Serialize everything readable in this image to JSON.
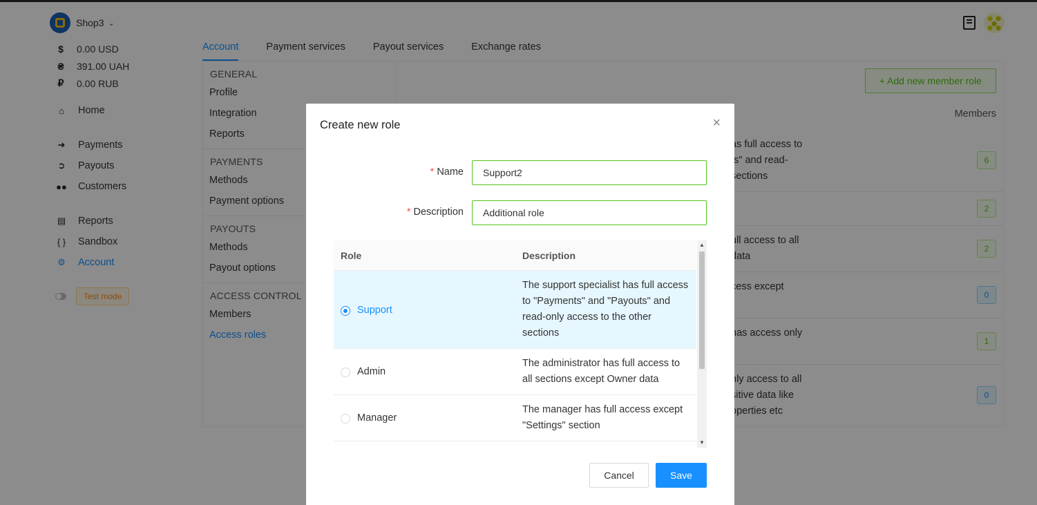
{
  "shop": {
    "name": "Shop3"
  },
  "balances": [
    {
      "symbol": "$",
      "amount": "0.00 USD"
    },
    {
      "symbol": "₴",
      "amount": "391.00 UAH"
    },
    {
      "symbol": "₽",
      "amount": "0.00 RUB"
    }
  ],
  "nav": {
    "home": "Home",
    "payments": "Payments",
    "payouts": "Payouts",
    "customers": "Customers",
    "reports": "Reports",
    "sandbox": "Sandbox",
    "account": "Account"
  },
  "test_mode": "Test mode",
  "tabs": [
    "Account",
    "Payment services",
    "Payout services",
    "Exchange rates"
  ],
  "settings_menu": {
    "general": {
      "heading": "GENERAL",
      "items": [
        "Profile",
        "Integration",
        "Reports"
      ]
    },
    "payments": {
      "heading": "PAYMENTS",
      "items": [
        "Methods",
        "Payment options"
      ]
    },
    "payouts": {
      "heading": "PAYOUTS",
      "items": [
        "Methods",
        "Payout options"
      ]
    },
    "access": {
      "heading": "ACCESS CONTROL",
      "items": [
        "Members",
        "Access roles"
      ]
    }
  },
  "roles_page": {
    "add_button": "Add new member role",
    "members_header": "Members",
    "rows": [
      {
        "desc_lines": [
          "as full access to",
          "ts\" and read-",
          " sections"
        ],
        "count": "6"
      },
      {
        "desc_lines": [],
        "count": "2"
      },
      {
        "desc_lines": [
          "ull access to all",
          "data"
        ],
        "count": "2"
      },
      {
        "desc_lines": [
          "cess except"
        ],
        "count": "0"
      },
      {
        "desc_lines": [
          "has access only"
        ],
        "count": "1"
      },
      {
        "desc_lines": [
          "nly access to all",
          "sitive data like",
          "operties etc"
        ],
        "count": "0"
      }
    ]
  },
  "modal": {
    "title": "Create new role",
    "name_label": "Name",
    "name_value": "Support2",
    "description_label": "Description",
    "description_value": "Additional role",
    "table": {
      "col_role": "Role",
      "col_description": "Description",
      "rows": [
        {
          "role": "Support",
          "selected": true,
          "desc_lines": [
            "The support specialist has full access",
            "to \"Payments\" and \"Payouts\" and",
            "read-only access to the other",
            "sections"
          ]
        },
        {
          "role": "Admin",
          "selected": false,
          "desc_lines": [
            "The administrator has full access to",
            "all sections except Owner data"
          ]
        },
        {
          "role": "Manager",
          "selected": false,
          "desc_lines": [
            "The manager has full access except",
            "\"Settings\" section"
          ]
        }
      ]
    },
    "cancel": "Cancel",
    "save": "Save"
  },
  "colors": {
    "accent": "#1890ff",
    "success": "#52c41a",
    "warning": "#fa8c16"
  }
}
